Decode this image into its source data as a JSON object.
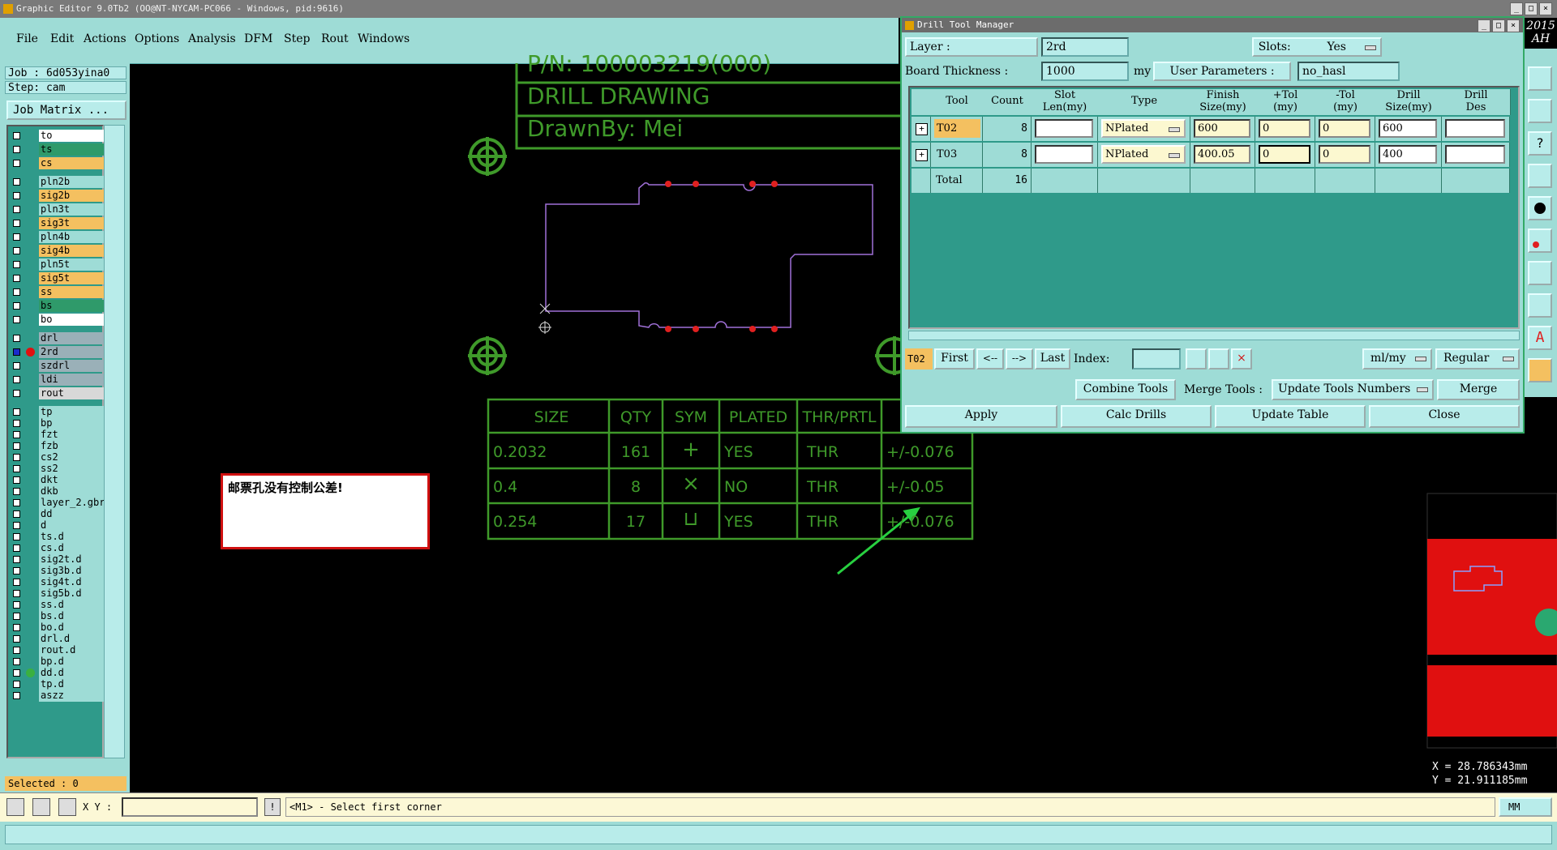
{
  "window_title": "Graphic Editor 9.0Tb2 (OO@NT-NYCAM-PC066 - Windows, pid:9616)",
  "menu": [
    "File",
    "Edit",
    "Actions",
    "Options",
    "Analysis",
    "DFM",
    "Step",
    "Rout",
    "Windows"
  ],
  "left": {
    "job": "Job : 6d053yina0",
    "step": "Step: cam",
    "job_matrix": "Job Matrix ...",
    "selected": "Selected : 0",
    "layers": [
      {
        "name": "to",
        "color": "#ffffff"
      },
      {
        "name": "ts",
        "color": "#2f9a6a"
      },
      {
        "name": "cs",
        "color": "#f4c060"
      },
      {
        "name": "pln2b",
        "color": "#9edcd6"
      },
      {
        "name": "sig2b",
        "color": "#f4c060"
      },
      {
        "name": "pln3t",
        "color": "#9edcd6"
      },
      {
        "name": "sig3t",
        "color": "#f4c060"
      },
      {
        "name": "pln4b",
        "color": "#9edcd6"
      },
      {
        "name": "sig4b",
        "color": "#f4c060"
      },
      {
        "name": "pln5t",
        "color": "#9edcd6"
      },
      {
        "name": "sig5t",
        "color": "#f4c060"
      },
      {
        "name": "ss",
        "color": "#f4c060"
      },
      {
        "name": "bs",
        "color": "#2f9a6a"
      },
      {
        "name": "bo",
        "color": "#ffffff"
      },
      {
        "name": "drl",
        "color": "#9ab0b8"
      },
      {
        "name": "2rd",
        "color": "#9ab0b8"
      },
      {
        "name": "szdrl",
        "color": "#9ab0b8"
      },
      {
        "name": "ldi",
        "color": "#9ab0b8"
      },
      {
        "name": "rout",
        "color": "#d8d8d8"
      },
      {
        "name": "tp",
        "color": "#9edcd6"
      },
      {
        "name": "bp",
        "color": "#9edcd6"
      },
      {
        "name": "fzt",
        "color": "#9edcd6"
      },
      {
        "name": "fzb",
        "color": "#9edcd6"
      },
      {
        "name": "cs2",
        "color": "#9edcd6"
      },
      {
        "name": "ss2",
        "color": "#9edcd6"
      },
      {
        "name": "dkt",
        "color": "#9edcd6"
      },
      {
        "name": "dkb",
        "color": "#9edcd6"
      },
      {
        "name": "layer_2.gbr",
        "color": "#9edcd6"
      },
      {
        "name": "dd",
        "color": "#9edcd6"
      },
      {
        "name": "d",
        "color": "#9edcd6"
      },
      {
        "name": "ts.d",
        "color": "#9edcd6"
      },
      {
        "name": "cs.d",
        "color": "#9edcd6"
      },
      {
        "name": "sig2t.d",
        "color": "#9edcd6"
      },
      {
        "name": "sig3b.d",
        "color": "#9edcd6"
      },
      {
        "name": "sig4t.d",
        "color": "#9edcd6"
      },
      {
        "name": "sig5b.d",
        "color": "#9edcd6"
      },
      {
        "name": "ss.d",
        "color": "#9edcd6"
      },
      {
        "name": "bs.d",
        "color": "#9edcd6"
      },
      {
        "name": "bo.d",
        "color": "#9edcd6"
      },
      {
        "name": "drl.d",
        "color": "#9edcd6"
      },
      {
        "name": "rout.d",
        "color": "#9edcd6"
      },
      {
        "name": "bp.d",
        "color": "#9edcd6"
      },
      {
        "name": "dd.d",
        "color": "#9edcd6"
      },
      {
        "name": "tp.d",
        "color": "#9edcd6"
      },
      {
        "name": "aszz",
        "color": "#9edcd6"
      }
    ]
  },
  "canvas": {
    "pn_text": "P/N:  100003219(000)",
    "drawing_title": "DRILL DRAWING",
    "drawn_by": "DrawnBy: Mei",
    "note": "邮票孔没有控制公差!",
    "drill_table": {
      "headers": [
        "SIZE",
        "QTY",
        "SYM",
        "PLATED",
        "THR/PRTL",
        ""
      ],
      "rows": [
        [
          "0.2032",
          "161",
          "+",
          "YES",
          "THR",
          "+/-0.076"
        ],
        [
          "0.4",
          "8",
          "×",
          "NO",
          "THR",
          "+/-0.05"
        ],
        [
          "0.254",
          "17",
          "⊔",
          "YES",
          "THR",
          "+/-0.076"
        ]
      ]
    },
    "coords": {
      "x": "X = 28.786343mm",
      "y": "Y = 21.911185mm"
    },
    "year_label": "2015",
    "year_sub": "AH"
  },
  "status": {
    "xy_label": "X Y :",
    "xy_value": "",
    "message": "<M1> - Select first corner",
    "units": "MM"
  },
  "dtm": {
    "title": "Drill Tool Manager",
    "layer_label": "Layer          :",
    "layer_value": "2rd",
    "slots_label": "Slots:",
    "slots_value": "Yes",
    "board_thickness_label": "Board Thickness :",
    "board_thickness_value": "1000",
    "board_thickness_unit": "my",
    "user_params_label": "User Parameters :",
    "user_params_value": "no_hasl",
    "columns": [
      "Tool",
      "Count",
      "Slot\nLen(my)",
      "Type",
      "Finish\nSize(my)",
      "+Tol\n(my)",
      "-Tol\n(my)",
      "Drill\nSize(my)",
      "Drill\nDes"
    ],
    "rows": [
      {
        "tool": "T02",
        "count": "8",
        "slot_len": "",
        "type": "NPlated",
        "finish": "600",
        "ptol": "0",
        "mtol": "0",
        "drill": "600",
        "des": ""
      },
      {
        "tool": "T03",
        "count": "8",
        "slot_len": "",
        "type": "NPlated",
        "finish": "400.05",
        "ptol": "0",
        "mtol": "0",
        "drill": "400",
        "des": ""
      }
    ],
    "total_label": "Total",
    "total_count": "16",
    "nav": {
      "current": "T02",
      "first": "First",
      "prev": "<--",
      "next": "-->",
      "last": "Last",
      "index_label": "Index:",
      "index_value": "",
      "units": "ml/my",
      "mode": "Regular"
    },
    "buttons": {
      "combine": "Combine Tools",
      "merge_label": "Merge Tools :",
      "update_numbers": "Update Tools Numbers",
      "merge": "Merge",
      "apply": "Apply",
      "calc": "Calc Drills",
      "update_table": "Update Table",
      "close": "Close"
    }
  }
}
